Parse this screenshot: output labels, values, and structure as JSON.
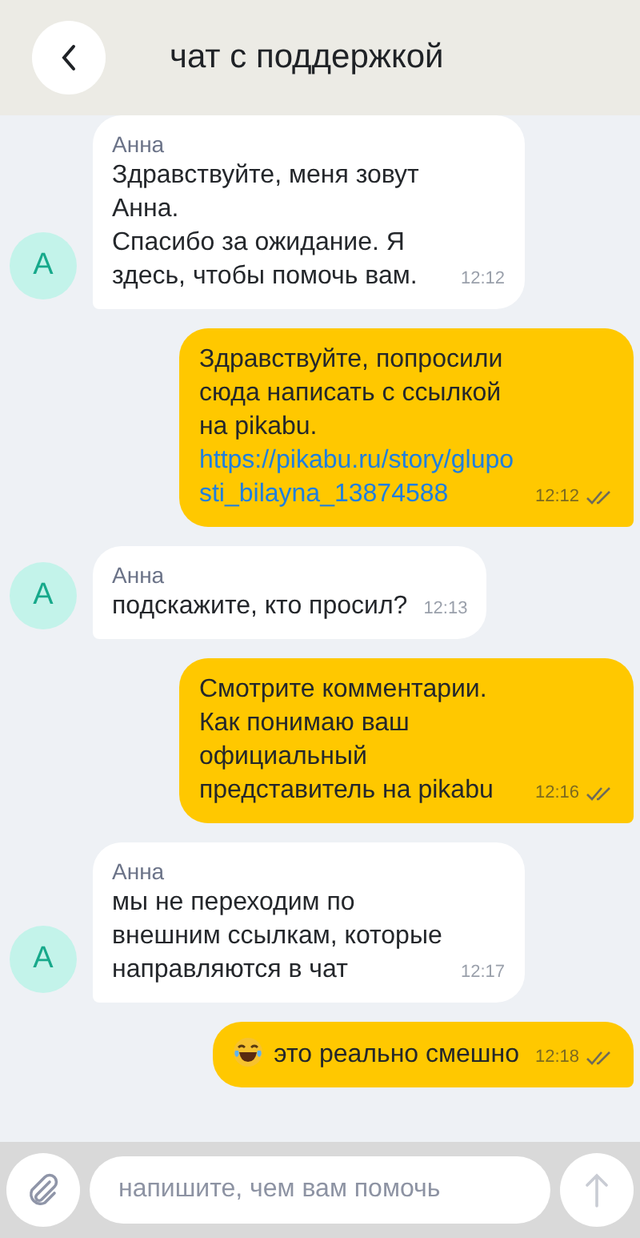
{
  "header": {
    "title": "чат с поддержкой"
  },
  "messages": [
    {
      "kind": "incoming",
      "sender": "Анна",
      "avatar": "А",
      "text": "Здравствуйте, меня зовут Анна.\nСпасибо за ожидание. Я здесь, чтобы помочь вам.",
      "time": "12:12"
    },
    {
      "kind": "outgoing",
      "text": "Здравствуйте, попросили сюда написать с ссылкой на pikabu.",
      "link": "https://pikabu.ru/story/gluposti_bilayna_13874588",
      "time": "12:12",
      "read": true
    },
    {
      "kind": "incoming",
      "sender": "Анна",
      "avatar": "А",
      "text": "подскажите, кто просил?",
      "time": "12:13"
    },
    {
      "kind": "outgoing",
      "text": "Смотрите комментарии. Как понимаю ваш официальный представитель на pikabu",
      "time": "12:16",
      "read": true
    },
    {
      "kind": "incoming",
      "sender": "Анна",
      "avatar": "А",
      "text": "мы не переходим по внешним ссылкам, которые направляются в чат",
      "time": "12:17"
    },
    {
      "kind": "outgoing",
      "emoji": true,
      "text": "это реально смешно",
      "time": "12:18",
      "read": true
    }
  ],
  "composer": {
    "placeholder": "напишите, чем вам помочь"
  }
}
